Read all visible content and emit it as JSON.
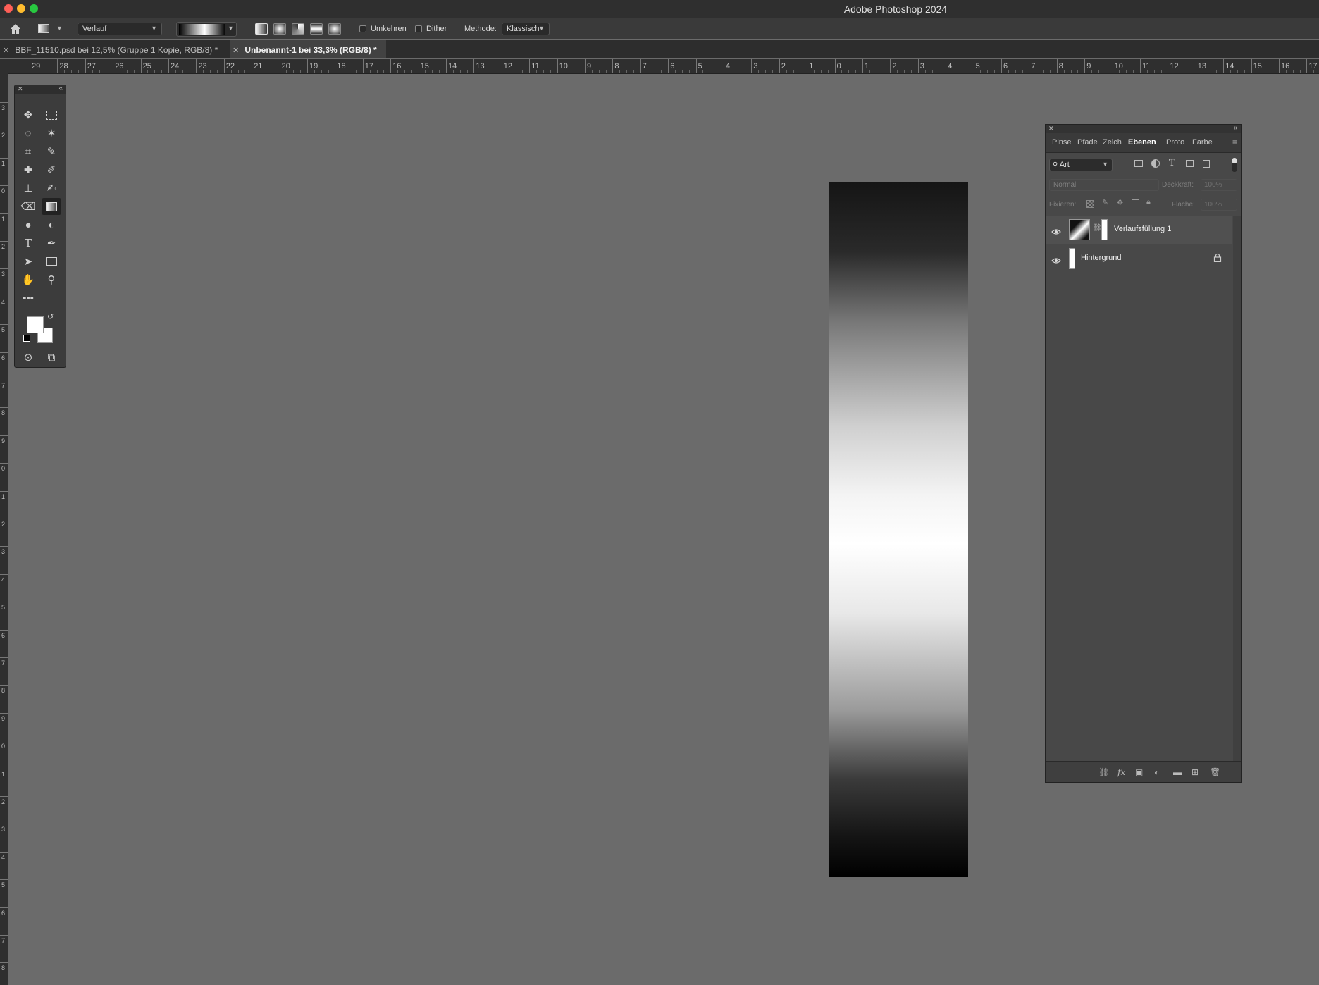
{
  "window": {
    "title": "Adobe Photoshop 2024"
  },
  "options_bar": {
    "preset_label": "Verlauf",
    "reverse_label": "Umkehren",
    "dither_label": "Dither",
    "method_label": "Methode:",
    "method_value": "Klassisch"
  },
  "doc_tabs": [
    {
      "label": "BBF_11510.psd bei 12,5% (Gruppe 1 Kopie, RGB/8) *",
      "active": false
    },
    {
      "label": "Unbenannt-1 bei 33,3% (RGB/8) *",
      "active": true
    }
  ],
  "ruler_h": [
    "29",
    "28",
    "27",
    "26",
    "25",
    "24",
    "23",
    "22",
    "21",
    "20",
    "19",
    "18",
    "17",
    "16",
    "15",
    "14",
    "13",
    "12",
    "11",
    "10",
    "9",
    "8",
    "7",
    "6",
    "5",
    "4",
    "3",
    "2",
    "1",
    "0",
    "1",
    "2",
    "3",
    "4",
    "5",
    "6",
    "7",
    "8",
    "9",
    "10",
    "11",
    "12",
    "13",
    "14",
    "15",
    "16",
    "17"
  ],
  "ruler_v": [
    "3",
    "2",
    "1",
    "0",
    "1",
    "2",
    "3",
    "4",
    "5",
    "6",
    "7",
    "8",
    "9",
    "0",
    "1",
    "2",
    "3",
    "4",
    "5",
    "6",
    "7",
    "8",
    "9",
    "0",
    "1",
    "2",
    "3",
    "4",
    "5",
    "6",
    "7",
    "8"
  ],
  "layers_panel": {
    "tabs": [
      "Pinse",
      "Pfade",
      "Zeich",
      "Ebenen",
      "Proto",
      "Farbe"
    ],
    "active_tab": "Ebenen",
    "filter_value": "Art",
    "blend_mode": "Normal",
    "opacity_label": "Deckkraft:",
    "opacity_value": "100%",
    "lock_label": "Fixieren:",
    "fill_label": "Fläche:",
    "fill_value": "100%",
    "layers": [
      {
        "name": "Verlaufsfüllung 1",
        "visible": true,
        "locked": false
      },
      {
        "name": "Hintergrund",
        "visible": true,
        "locked": true
      }
    ]
  }
}
